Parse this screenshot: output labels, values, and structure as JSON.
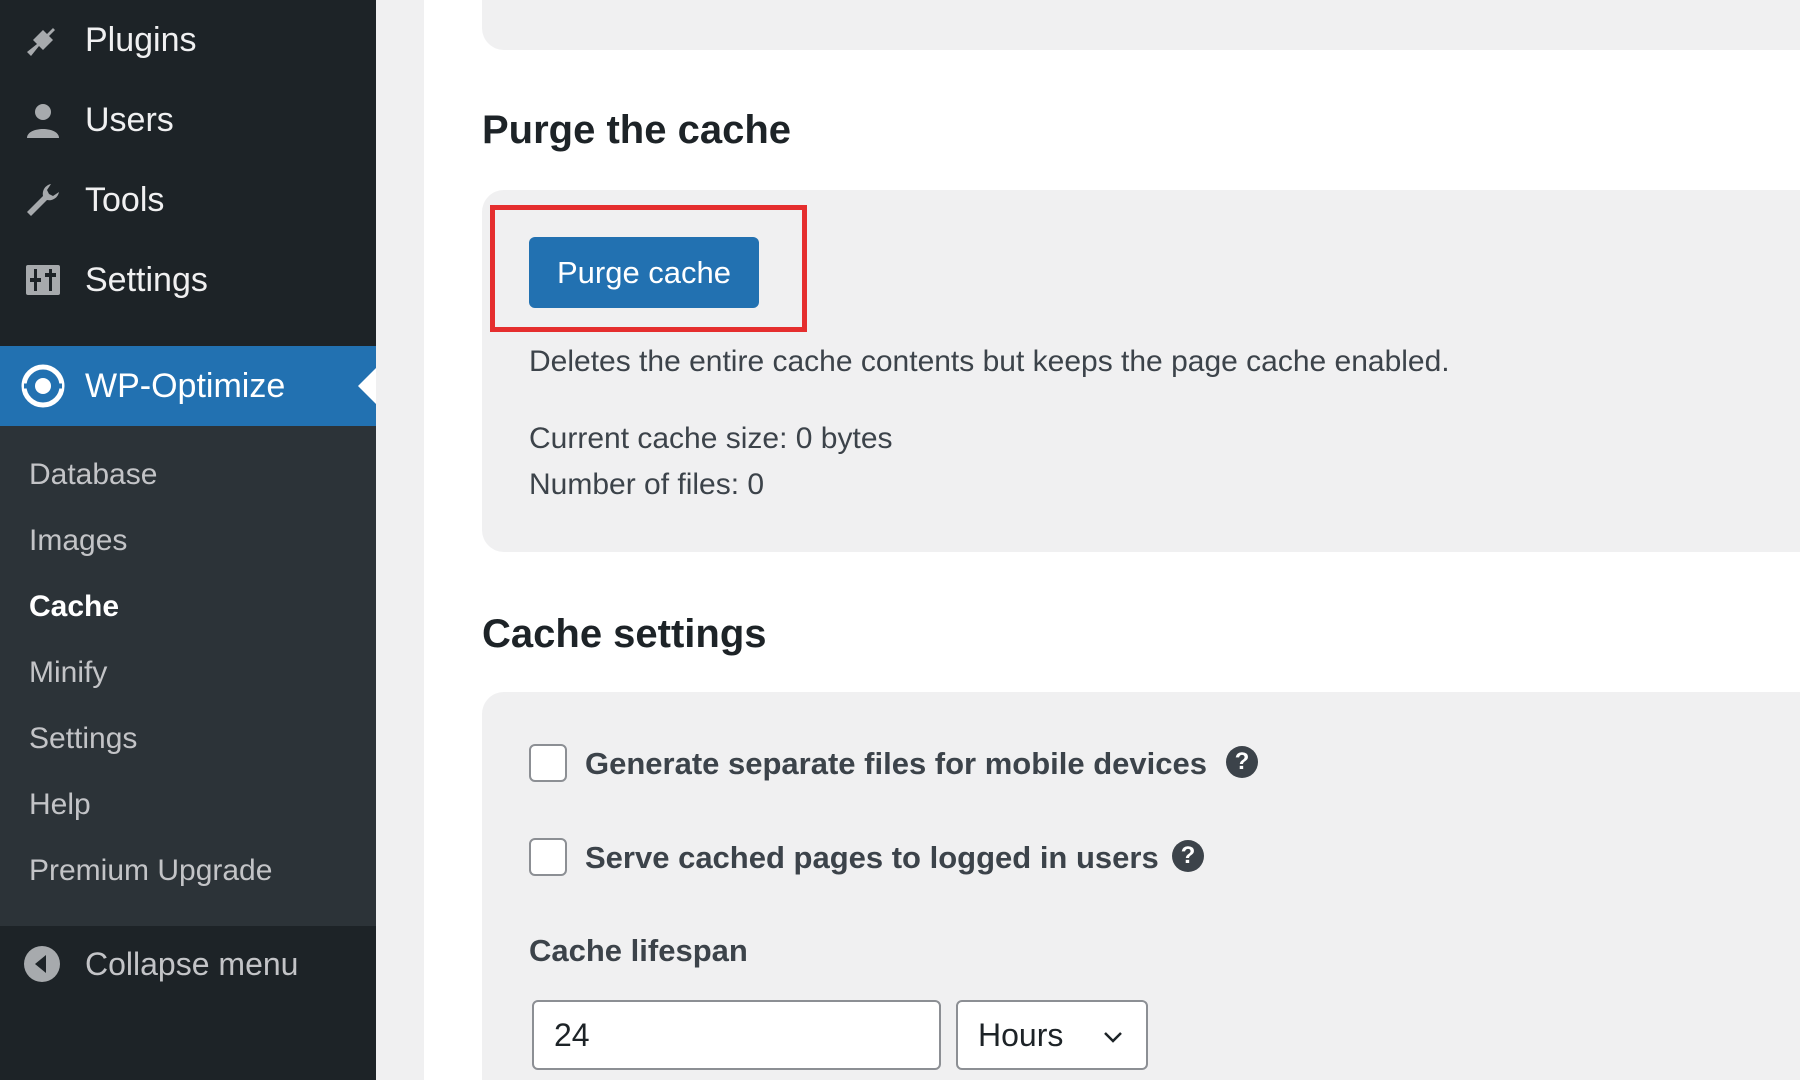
{
  "sidebar": {
    "items": [
      {
        "label": "Plugins",
        "icon": "plugin-icon"
      },
      {
        "label": "Users",
        "icon": "user-icon"
      },
      {
        "label": "Tools",
        "icon": "wrench-icon"
      },
      {
        "label": "Settings",
        "icon": "settings-sliders-icon"
      }
    ],
    "active": {
      "label": "WP-Optimize",
      "icon": "wp-optimize-logo-icon"
    },
    "submenu": [
      "Database",
      "Images",
      "Cache",
      "Minify",
      "Settings",
      "Help",
      "Premium Upgrade"
    ],
    "current_submenu": "Cache",
    "collapse_label": "Collapse menu"
  },
  "purge": {
    "heading": "Purge the cache",
    "button_label": "Purge cache",
    "description": "Deletes the entire cache contents but keeps the page cache enabled.",
    "cache_size": "Current cache size: 0 bytes",
    "file_count": "Number of files: 0"
  },
  "settings": {
    "heading": "Cache settings",
    "options": [
      {
        "label": "Generate separate files for mobile devices",
        "checked": false
      },
      {
        "label": "Serve cached pages to logged in users",
        "checked": false
      }
    ],
    "help_glyph": "?",
    "lifespan_label": "Cache lifespan",
    "lifespan_value": "24",
    "lifespan_unit": "Hours"
  },
  "colors": {
    "sidebar_bg": "#1d2327",
    "submenu_bg": "#2c3338",
    "accent": "#2271b1",
    "highlight_border": "#e52e2e",
    "panel_bg": "#f0f0f1"
  }
}
